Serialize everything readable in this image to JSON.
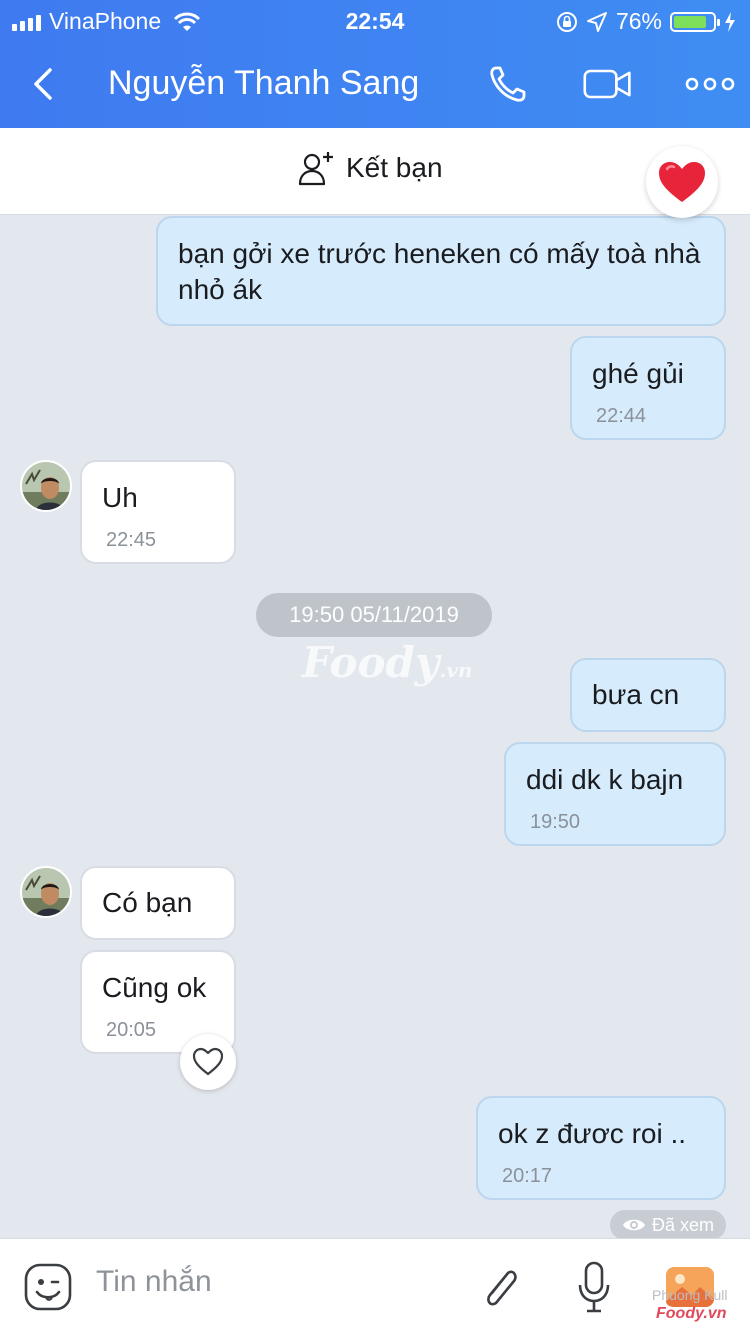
{
  "status_bar": {
    "carrier": "VinaPhone",
    "time": "22:54",
    "battery": "76%"
  },
  "header": {
    "title": "Nguyễn Thanh Sang"
  },
  "friend_bar": {
    "label": "Kết bạn"
  },
  "messages": [
    {
      "text": "bạn gởi xe trước heneken có mấy toà nhà nhỏ ák",
      "line2": "",
      "time": ""
    },
    {
      "text": "ghé gủi",
      "time": "22:44"
    },
    {
      "text": "Uh",
      "time": "22:45"
    },
    {
      "text": "bưa cn",
      "time": ""
    },
    {
      "text": "ddi dk k bajn",
      "time": "19:50"
    },
    {
      "text": "Có bạn",
      "time": ""
    },
    {
      "text": "Cũng ok",
      "time": "20:05"
    },
    {
      "text": "ok z đươc roi ..",
      "time": "20:17"
    }
  ],
  "date_separator": "19:50 05/11/2019",
  "watermark": {
    "brand": "Foody",
    "suffix": ".vn",
    "credit": "Phuong Kull"
  },
  "seen_label": "Đã xem",
  "composer": {
    "placeholder": "Tin nhắn"
  },
  "colors": {
    "header": "#3f7af0",
    "bubble_me": "#d6ebfc",
    "bubble_them": "#ffffff",
    "background": "#e3e7ee"
  }
}
